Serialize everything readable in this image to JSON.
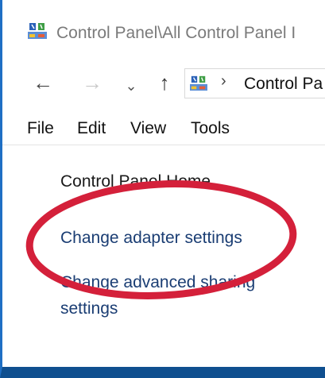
{
  "window": {
    "title": "Control Panel\\All Control Panel I",
    "icon": "control-panel-icon"
  },
  "nav": {
    "back": "←",
    "forward": "→",
    "recent_dropdown": "⌄",
    "up": "↑",
    "address_separator": "›",
    "address_text": "Control Pa"
  },
  "menu": {
    "file": "File",
    "edit": "Edit",
    "view": "View",
    "tools": "Tools"
  },
  "left_pane": {
    "home": "Control Panel Home",
    "change_adapter": "Change adapter settings",
    "change_sharing": "Change advanced sharing settings"
  },
  "colors": {
    "accent_border": "#1f6fc4",
    "link": "#1a3d73",
    "annotation": "#d4203a"
  }
}
